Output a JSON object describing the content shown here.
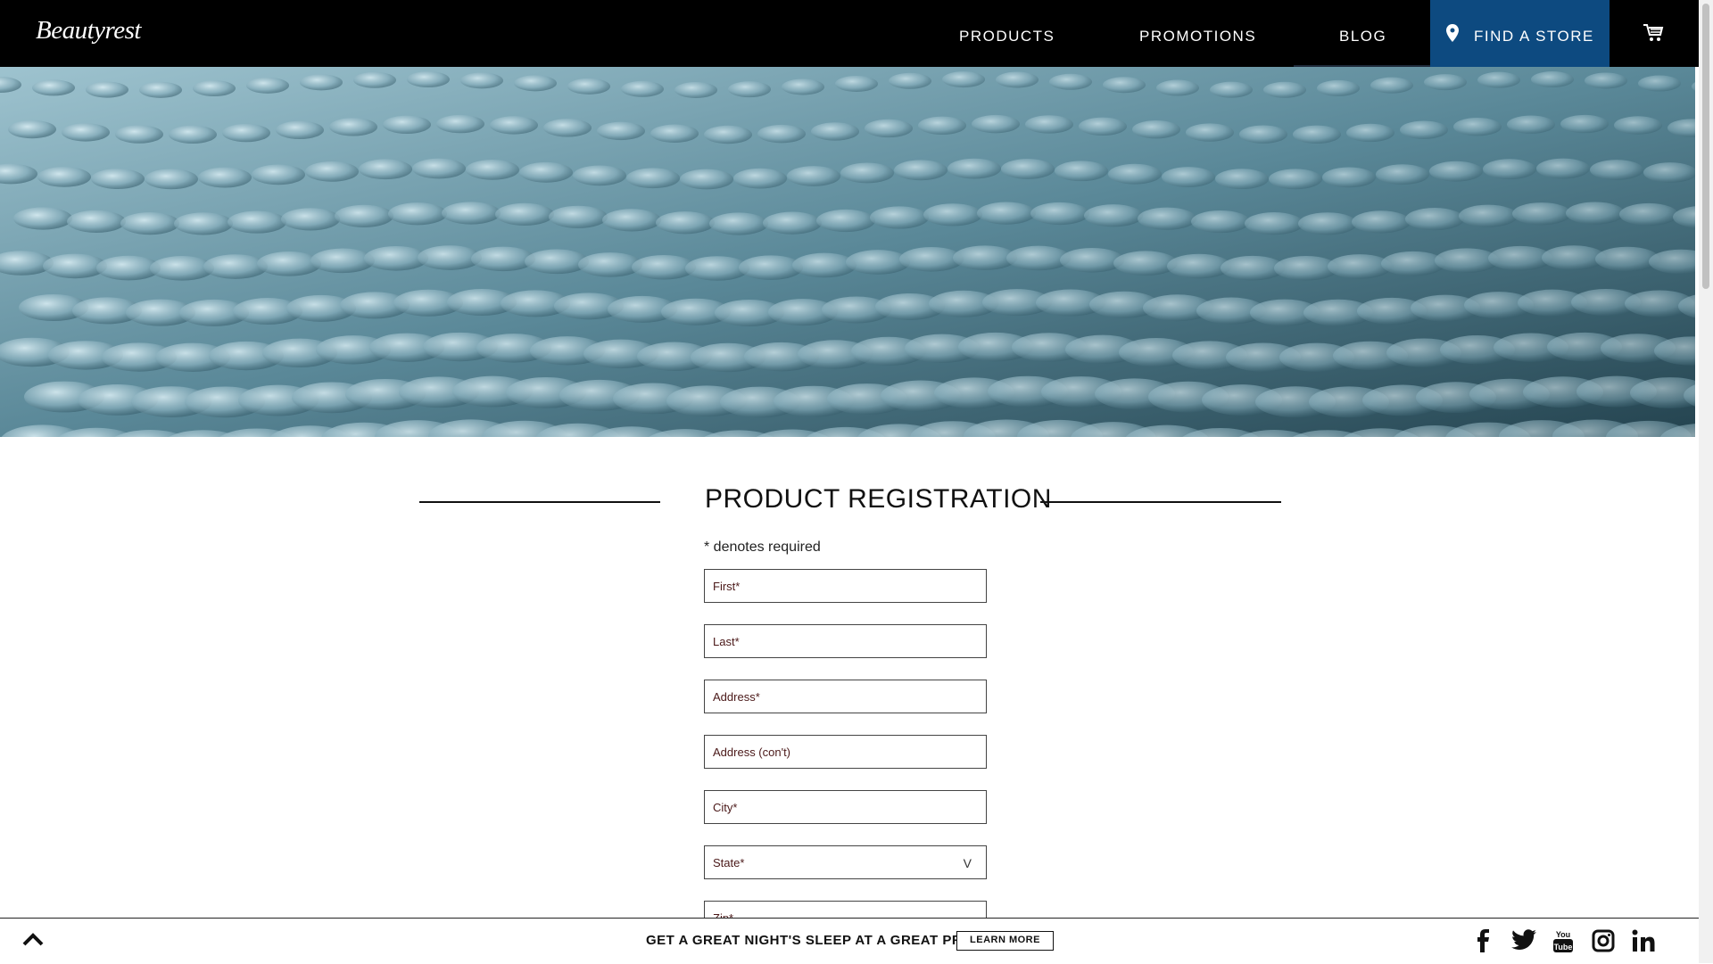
{
  "header": {
    "logo_text": "Beautyrest",
    "nav": {
      "products": "PRODUCTS",
      "promotions": "PROMOTIONS",
      "blog": "BLOG",
      "find_store": "FIND A STORE"
    },
    "find_store_color": "#0d4a80"
  },
  "main": {
    "title": "PRODUCT REGISTRATION",
    "required_note": "* denotes required",
    "fields": {
      "first": "First*",
      "last": "Last*",
      "address": "Address*",
      "address2": "Address (con't)",
      "city": "City*",
      "state": "State*",
      "zip": "Zip*"
    }
  },
  "footer_bar": {
    "promo_text": "GET A GREAT NIGHT'S SLEEP AT A GREAT PRICE",
    "learn_more": "LEARN MORE",
    "social_icons": [
      "facebook-icon",
      "twitter-icon",
      "youtube-icon",
      "instagram-icon",
      "linkedin-icon"
    ]
  }
}
